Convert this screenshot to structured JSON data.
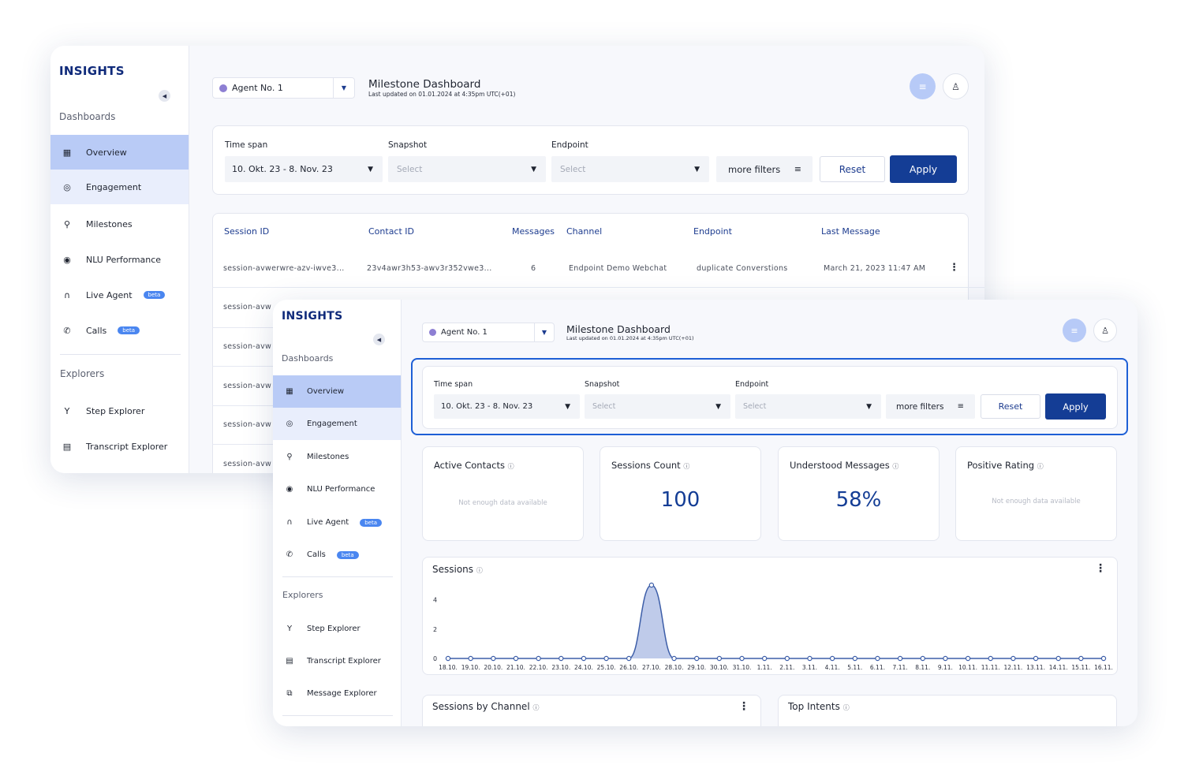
{
  "app": {
    "logo": "INSIGHTS"
  },
  "sidebar": {
    "dashboards_label": "Dashboards",
    "explorers_label": "Explorers",
    "items": [
      {
        "label": "Overview",
        "icon": "grid-icon",
        "glyph": "▦"
      },
      {
        "label": "Engagement",
        "icon": "engagement-icon",
        "glyph": "◎"
      },
      {
        "label": "Milestones",
        "icon": "milestone-icon",
        "glyph": "⚲"
      },
      {
        "label": "NLU Performance",
        "icon": "nlu-icon",
        "glyph": "◉"
      },
      {
        "label": "Live Agent",
        "icon": "headset-icon",
        "glyph": "∩",
        "badge": "beta"
      },
      {
        "label": "Calls",
        "icon": "phone-icon",
        "glyph": "✆",
        "badge": "beta"
      }
    ],
    "explorers": [
      {
        "label": "Step Explorer",
        "icon": "branch-icon",
        "glyph": "Y"
      },
      {
        "label": "Transcript Explorer",
        "icon": "chat-icon",
        "glyph": "▤"
      },
      {
        "label": "Message Explorer",
        "icon": "messages-icon",
        "glyph": "⧉"
      }
    ]
  },
  "header": {
    "agent": "Agent No. 1",
    "title": "Milestone Dashboard",
    "updated": "Last updated on 01.01.2024 at 4:35pm UTC(+01)"
  },
  "filters": {
    "timespan_label": "Time span",
    "timespan_value": "10. Okt. 23 - 8. Nov. 23",
    "snapshot_label": "Snapshot",
    "snapshot_placeholder": "Select",
    "endpoint_label": "Endpoint",
    "endpoint_placeholder": "Select",
    "more_filters": "more filters",
    "reset": "Reset",
    "apply": "Apply"
  },
  "table": {
    "columns": [
      "Session ID",
      "Contact ID",
      "Messages",
      "Channel",
      "Endpoint",
      "Last Message"
    ],
    "first_row": [
      "session-avwerwre-azv-iwve3...",
      "23v4awr3h53-awv3r352vwe3...",
      "6",
      "Endpoint Demo Webchat",
      "duplicate Converstions",
      "March 21, 2023 11:47 AM"
    ],
    "row_prefix": "session-avw"
  },
  "kpis": [
    {
      "title": "Active Contacts",
      "value": "",
      "empty": "Not enough data available"
    },
    {
      "title": "Sessions Count",
      "value": "100",
      "empty": ""
    },
    {
      "title": "Understood Messages",
      "value": "58%",
      "empty": ""
    },
    {
      "title": "Positive Rating",
      "value": "",
      "empty": "Not enough data available"
    }
  ],
  "bottom_cards": [
    "Sessions by Channel",
    "Top Intents"
  ],
  "chart_data": {
    "type": "line",
    "title": "Sessions",
    "x": [
      "18.10.",
      "19.10.",
      "20.10.",
      "21.10.",
      "22.10.",
      "23.10.",
      "24.10.",
      "25.10.",
      "26.10.",
      "27.10.",
      "28.10.",
      "29.10.",
      "30.10.",
      "31.10.",
      "1.11.",
      "2.11.",
      "3.11.",
      "4.11.",
      "5.11.",
      "6.11.",
      "7.11.",
      "8.11.",
      "9.11.",
      "10.11.",
      "11.11.",
      "12.11.",
      "13.11.",
      "14.11.",
      "15.11.",
      "16.11."
    ],
    "values": [
      0,
      0,
      0,
      0,
      0,
      0,
      0,
      0,
      0,
      5,
      0,
      0,
      0,
      0,
      0,
      0,
      0,
      0,
      0,
      0,
      0,
      0,
      0,
      0,
      0,
      0,
      0,
      0,
      0,
      0
    ],
    "yticks": [
      "0",
      "2",
      "4"
    ],
    "ylim": [
      0,
      5
    ],
    "series_color": "#3d5ea8",
    "fill_color": "#b4c2e6"
  },
  "colors": {
    "accent": "#143d95",
    "highlight": "#1e5fd6",
    "active_nav": "#b9cbf6"
  }
}
